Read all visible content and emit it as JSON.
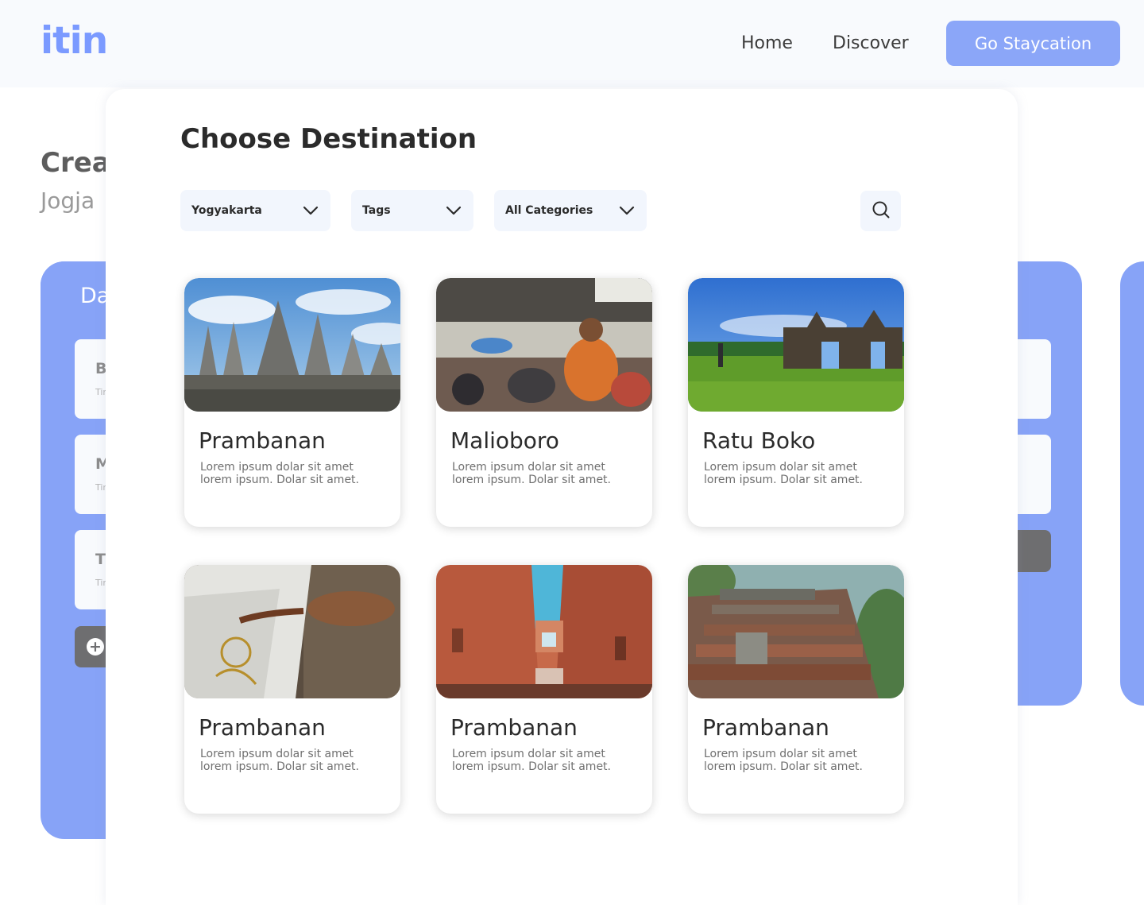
{
  "header": {
    "logo": "itin",
    "nav": {
      "home": "Home",
      "discover": "Discover"
    },
    "cta": "Go Staycation"
  },
  "background": {
    "title": "Crea",
    "subtitle": "Jogja",
    "day_label": "Da",
    "cards": [
      {
        "letter": "B",
        "sub": "Tir"
      },
      {
        "letter": "M",
        "sub": "Tir"
      },
      {
        "letter": "T",
        "sub": "Tir"
      }
    ],
    "add_icon": "+"
  },
  "modal": {
    "title": "Choose Destination",
    "filters": [
      "Yogyakarta",
      "Tags",
      "All Categories"
    ],
    "search_icon": "search-icon",
    "destinations": [
      {
        "name": "Prambanan",
        "desc_line1": "Lorem ipsum dolar sit amet",
        "desc_line2": "lorem ipsum. Dolar sit amet."
      },
      {
        "name": "Malioboro",
        "desc_line1": "Lorem ipsum dolar sit amet",
        "desc_line2": "lorem ipsum. Dolar sit amet."
      },
      {
        "name": "Ratu Boko",
        "desc_line1": "Lorem ipsum dolar sit amet",
        "desc_line2": "lorem ipsum. Dolar sit amet."
      },
      {
        "name": "Prambanan",
        "desc_line1": "Lorem ipsum dolar sit amet",
        "desc_line2": "lorem ipsum. Dolar sit amet."
      },
      {
        "name": "Prambanan",
        "desc_line1": "Lorem ipsum dolar sit amet",
        "desc_line2": "lorem ipsum. Dolar sit amet."
      },
      {
        "name": "Prambanan",
        "desc_line1": "Lorem ipsum dolar sit amet",
        "desc_line2": "lorem ipsum. Dolar sit amet."
      }
    ]
  },
  "colors": {
    "accent": "#87a3f7",
    "cta": "#8ba6f8",
    "logo": "#7b9aff",
    "filter_bg": "#f2f6fd",
    "dark_button": "#6e6e70"
  }
}
